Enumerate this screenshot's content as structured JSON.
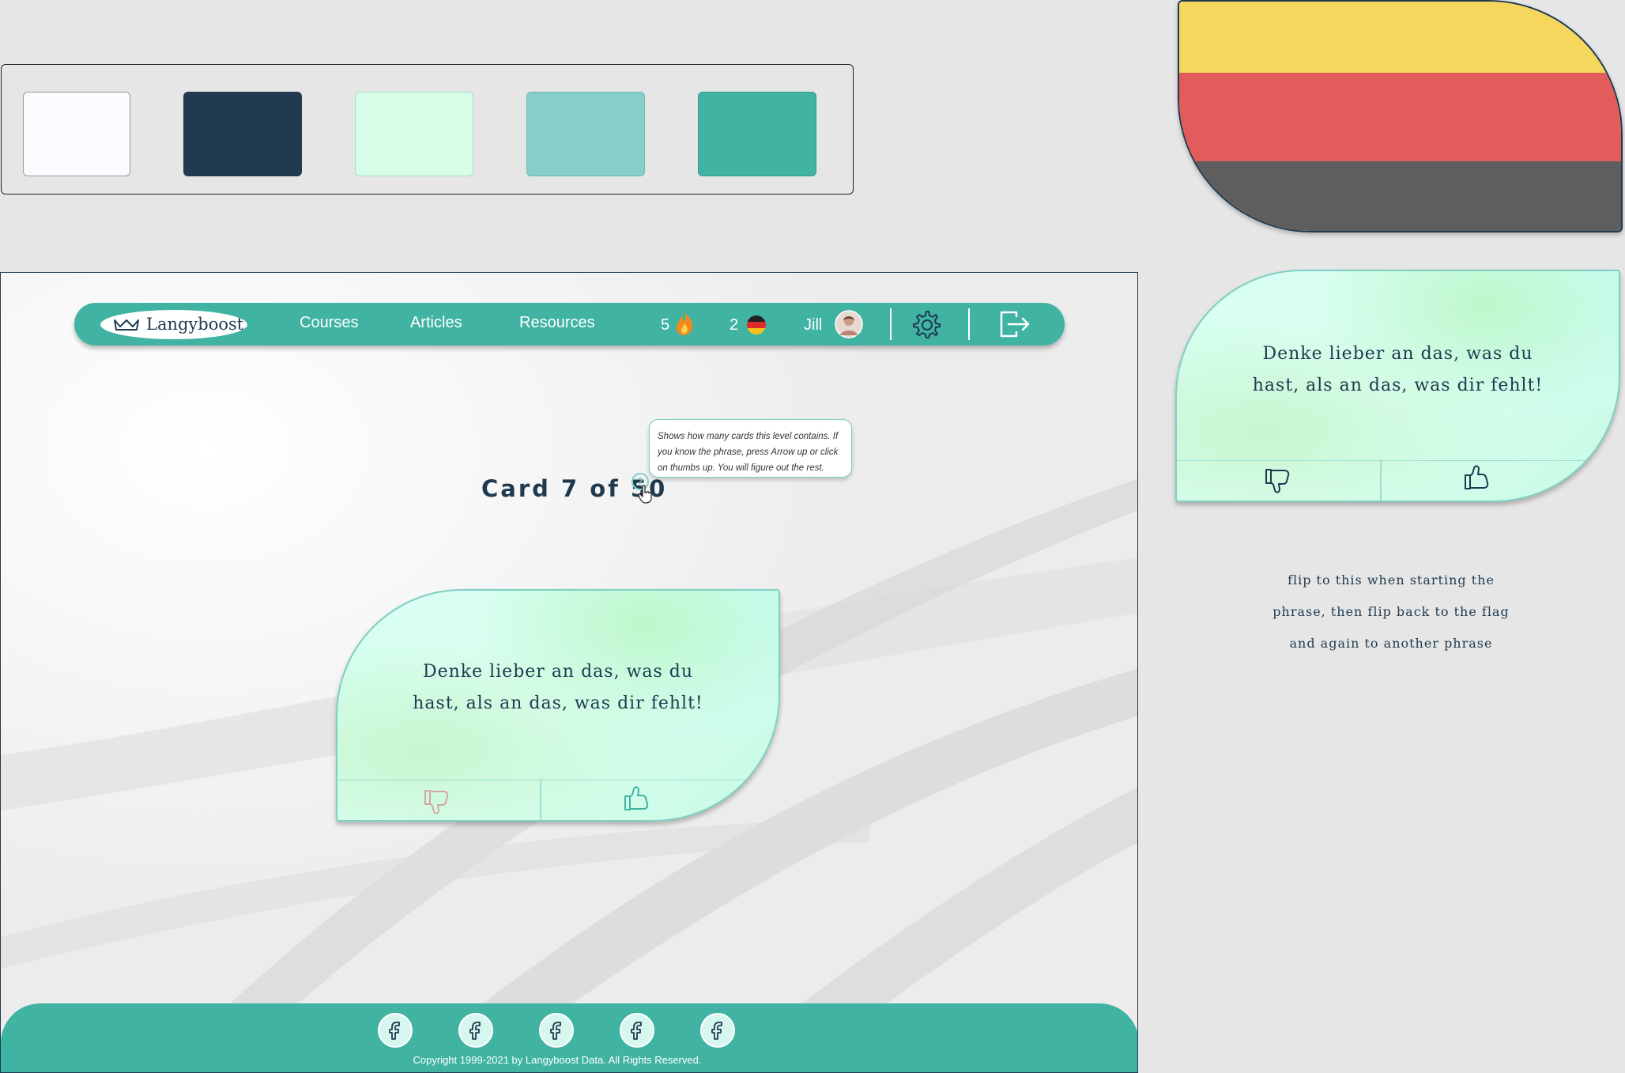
{
  "palette": {
    "colors": [
      "#fafbff",
      "#213a50",
      "#d7fde9",
      "#87cdc9",
      "#40b3a2"
    ]
  },
  "flag": {
    "colors": [
      "#f6d75e",
      "#e25c5c",
      "#5e5e5e"
    ]
  },
  "nav": {
    "brand": "Langyboost",
    "links": [
      "Courses",
      "Articles",
      "Resources"
    ],
    "streak": "5",
    "language_count": "2",
    "user_name": "Jill",
    "icons": [
      "crown-icon",
      "fire-icon",
      "german-flag-icon",
      "avatar",
      "gear-icon",
      "logout-icon"
    ]
  },
  "progress": {
    "label": "Card 7 of 50",
    "current": 7,
    "total": 50
  },
  "tooltip": {
    "text": "Shows how many cards this level contains. If you know the phrase, press Arrow up or click on thumbs up. You will figure out the rest."
  },
  "card": {
    "phrase_line1": "Denke lieber an das, was du",
    "phrase_line2": "hast, als an das, was dir fehlt!"
  },
  "side_card": {
    "phrase_line1": "Denke lieber an das, was du",
    "phrase_line2": "hast, als an das, was dir fehlt!"
  },
  "note": {
    "line1": "flip to this when starting the",
    "line2": "phrase, then flip back to the flag",
    "line3": "and again to another phrase"
  },
  "footer": {
    "social_icons": [
      "facebook-icon",
      "facebook-icon",
      "facebook-icon",
      "facebook-icon",
      "facebook-icon"
    ],
    "copyright": "Copyright 1999-2021 by Langyboost Data. All Rights Reserved."
  }
}
